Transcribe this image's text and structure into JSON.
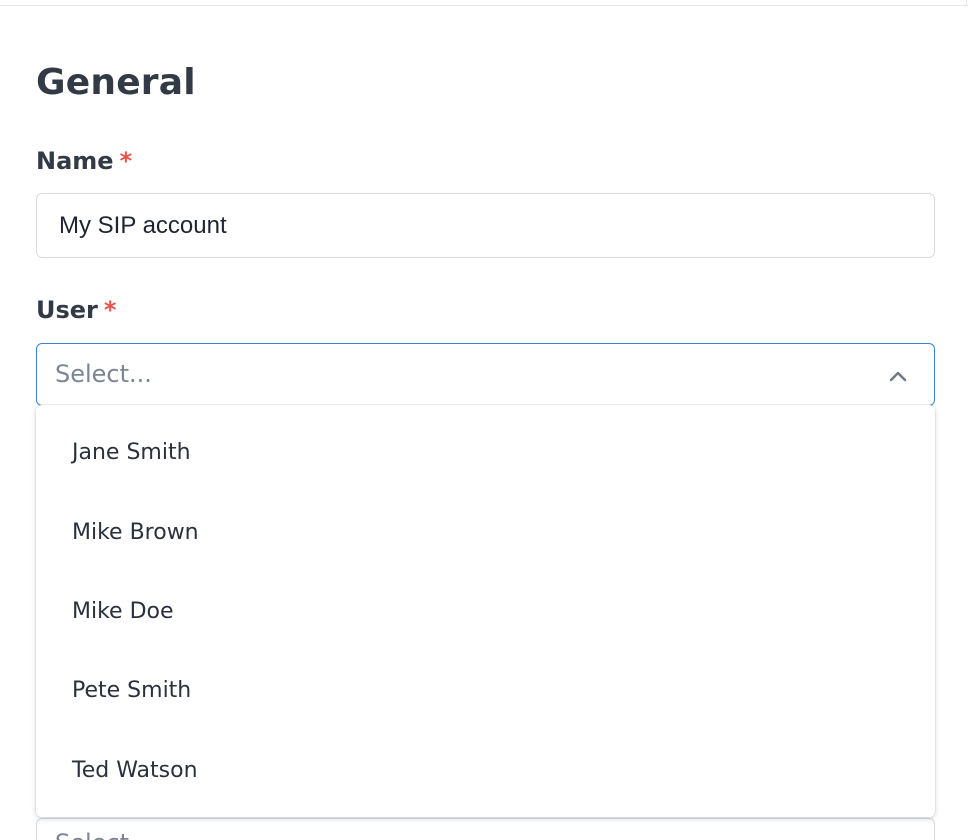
{
  "section": {
    "title": "General"
  },
  "name_field": {
    "label": "Name",
    "required_mark": "*",
    "value": "My SIP account"
  },
  "user_field": {
    "label": "User",
    "required_mark": "*",
    "placeholder": "Select...",
    "expanded": true,
    "options": [
      {
        "label": "Jane Smith"
      },
      {
        "label": "Mike Brown"
      },
      {
        "label": "Mike Doe"
      },
      {
        "label": "Pete Smith"
      },
      {
        "label": "Ted Watson"
      }
    ]
  },
  "next_field": {
    "placeholder": "Select..."
  },
  "colors": {
    "required": "#e5534b",
    "focus_border": "#3b82d6",
    "text": "#323a46",
    "placeholder": "#7b8594"
  }
}
